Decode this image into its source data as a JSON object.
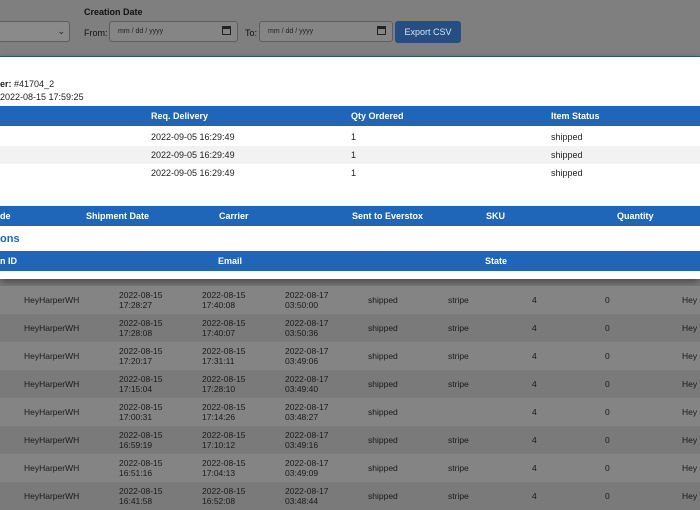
{
  "filters": {
    "creation_date_label": "Creation Date",
    "from_label": "From:",
    "to_label": "To:",
    "from_placeholder": "mm / dd / yyyy",
    "to_placeholder": "mm / dd / yyyy",
    "export_label": "Export CSV"
  },
  "modal": {
    "order_label": "er:",
    "order_number": "#41704_2",
    "order_date": "2022-08-15 17:59:25",
    "items_table": {
      "headers": [
        "Req. Delivery",
        "Qty Ordered",
        "Item Status"
      ],
      "rows": [
        [
          "2022-09-05 16:29:49",
          "1",
          "shipped"
        ],
        [
          "2022-09-05 16:29:49",
          "1",
          "shipped"
        ],
        [
          "2022-09-05 16:29:49",
          "1",
          "shipped"
        ]
      ]
    },
    "shipments_table": {
      "headers": [
        "de",
        "Shipment Date",
        "Carrier",
        "Sent to Everstox",
        "SKU",
        "Quantity"
      ]
    },
    "section_title": "ons",
    "transactions_table": {
      "headers": [
        "n ID",
        "Email",
        "State"
      ]
    }
  },
  "background_rows": [
    {
      "name": "HeyHarperWH",
      "d1": "2022-08-15",
      "t1": "17:28:27",
      "d2": "2022-08-15",
      "t2": "17:40:08",
      "d3": "2022-08-17",
      "t3": "03:50:00",
      "status": "shipped",
      "payment": "stripe",
      "qty": "4",
      "zero": "0",
      "tail": "Hey"
    },
    {
      "name": "HeyHarperWH",
      "d1": "2022-08-15",
      "t1": "17:28:08",
      "d2": "2022-08-15",
      "t2": "17:40:07",
      "d3": "2022-08-17",
      "t3": "03:50:36",
      "status": "shipped",
      "payment": "stripe",
      "qty": "4",
      "zero": "0",
      "tail": "Hey"
    },
    {
      "name": "HeyHarperWH",
      "d1": "2022-08-15",
      "t1": "17:20:17",
      "d2": "2022-08-15",
      "t2": "17:31:11",
      "d3": "2022-08-17",
      "t3": "03:49:06",
      "status": "shipped",
      "payment": "stripe",
      "qty": "4",
      "zero": "0",
      "tail": "Hey"
    },
    {
      "name": "HeyHarperWH",
      "d1": "2022-08-15",
      "t1": "17:15:04",
      "d2": "2022-08-15",
      "t2": "17:28:10",
      "d3": "2022-08-17",
      "t3": "03:49:40",
      "status": "shipped",
      "payment": "stripe",
      "qty": "4",
      "zero": "0",
      "tail": "Hey"
    },
    {
      "name": "HeyHarperWH",
      "d1": "2022-08-15",
      "t1": "17:00:31",
      "d2": "2022-08-15",
      "t2": "17:14:26",
      "d3": "2022-08-17",
      "t3": "03:48:27",
      "status": "shipped",
      "payment": "",
      "qty": "4",
      "zero": "0",
      "tail": "Hey"
    },
    {
      "name": "HeyHarperWH",
      "d1": "2022-08-15",
      "t1": "16:59:19",
      "d2": "2022-08-15",
      "t2": "17:10:12",
      "d3": "2022-08-17",
      "t3": "03:49:16",
      "status": "shipped",
      "payment": "stripe",
      "qty": "4",
      "zero": "0",
      "tail": "Hey"
    },
    {
      "name": "HeyHarperWH",
      "d1": "2022-08-15",
      "t1": "16:51:16",
      "d2": "2022-08-15",
      "t2": "17:04:13",
      "d3": "2022-08-17",
      "t3": "03:49:09",
      "status": "shipped",
      "payment": "stripe",
      "qty": "4",
      "zero": "0",
      "tail": "Hey"
    },
    {
      "name": "HeyHarperWH",
      "d1": "2022-08-15",
      "t1": "16:41:58",
      "d2": "2022-08-15",
      "t2": "16:52:08",
      "d3": "2022-08-17",
      "t3": "03:48:44",
      "status": "shipped",
      "payment": "stripe",
      "qty": "4",
      "zero": "0",
      "tail": "Hey"
    }
  ],
  "colors": {
    "header_blue": "#1f66b8",
    "export_button": "#264e83",
    "overlay_gray": "#7d7d7d"
  }
}
